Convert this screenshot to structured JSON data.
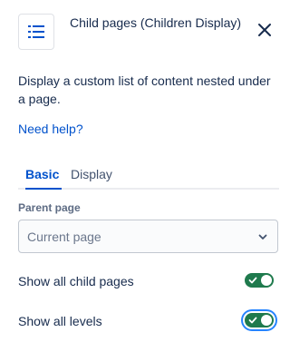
{
  "header": {
    "icon": "list-icon",
    "title": "Child pages (Children Display)",
    "close_icon": "close-icon"
  },
  "description": "Display a custom list of content nested under a page.",
  "help_link": "Need help?",
  "tabs": [
    {
      "label": "Basic",
      "active": true
    },
    {
      "label": "Display",
      "active": false
    }
  ],
  "parent_page": {
    "label": "Parent page",
    "value": "Current page"
  },
  "toggles": [
    {
      "label": "Show all child pages",
      "on": true
    },
    {
      "label": "Show all levels",
      "on": true
    }
  ],
  "colors": {
    "accent": "#0052cc",
    "toggle_on": "#1f7a4d",
    "focus_ring": "#2684ff"
  }
}
